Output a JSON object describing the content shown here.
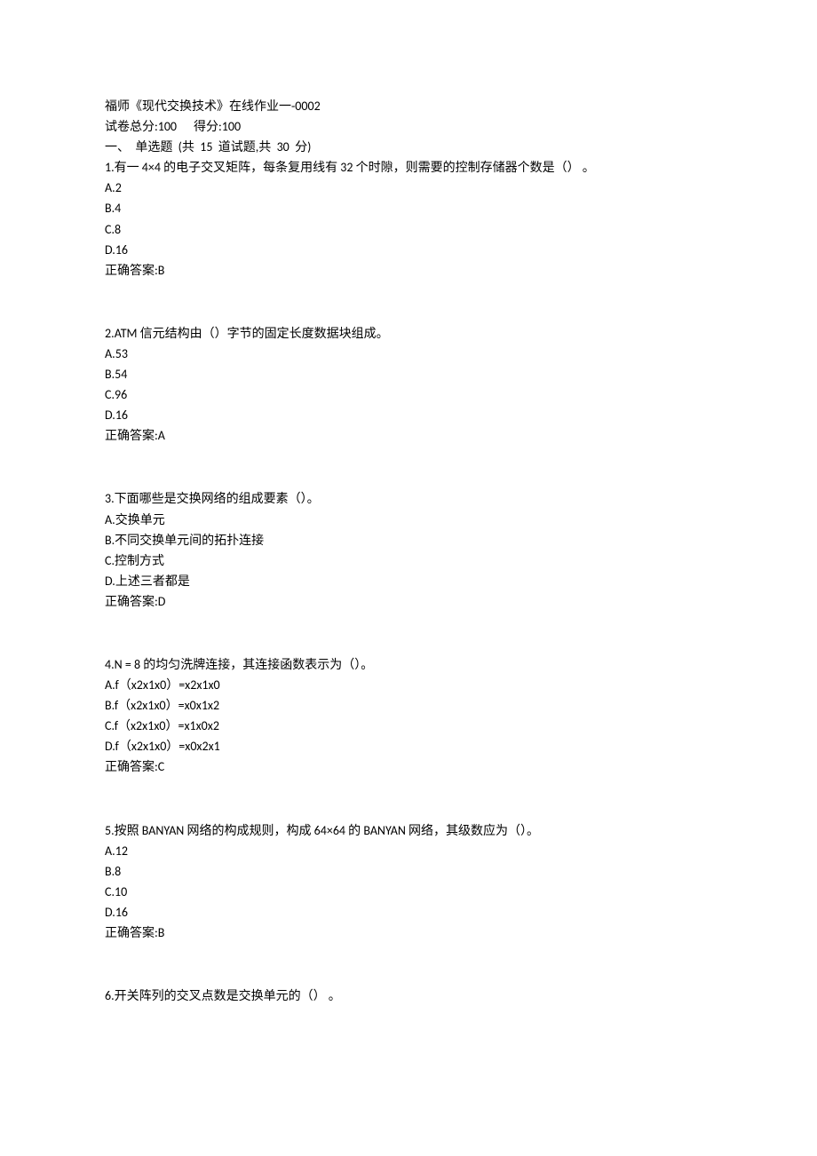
{
  "header": {
    "title": "福师《现代交换技术》在线作业一-0002",
    "score_line": "试卷总分:100      得分:100",
    "section_line": "一、  单选题  (共  15  道试题,共  30  分)"
  },
  "questions": [
    {
      "stem": "1.有一 4×4 的电子交叉矩阵，每条复用线有 32 个时隙，则需要的控制存储器个数是（） 。",
      "opts": [
        "A.2",
        "B.4",
        "C.8",
        "D.16"
      ],
      "answer": "正确答案:B"
    },
    {
      "stem": "2.ATM 信元结构由（）字节的固定长度数据块组成。",
      "opts": [
        "A.53",
        "B.54",
        "C.96",
        "D.16"
      ],
      "answer": "正确答案:A"
    },
    {
      "stem": "3.下面哪些是交换网络的组成要素（）。",
      "opts": [
        "A.交换单元",
        "B.不同交换单元间的拓扑连接",
        "C.控制方式",
        "D.上述三者都是"
      ],
      "answer": "正确答案:D"
    },
    {
      "stem": "4.N = 8 的均匀洗牌连接，其连接函数表示为（）。",
      "opts": [
        "A.f（x2x1x0）=x2x1x0",
        "B.f（x2x1x0）=x0x1x2",
        "C.f（x2x1x0）=x1x0x2",
        "D.f（x2x1x0）=x0x2x1"
      ],
      "answer": "正确答案:C"
    },
    {
      "stem": "5.按照 BANYAN 网络的构成规则，构成 64×64 的 BANYAN 网络，其级数应为（）。",
      "opts": [
        "A.12",
        "B.8",
        "C.10",
        "D.16"
      ],
      "answer": "正确答案:B"
    },
    {
      "stem": "6.开关阵列的交叉点数是交换单元的（） 。",
      "opts": [],
      "answer": ""
    }
  ]
}
